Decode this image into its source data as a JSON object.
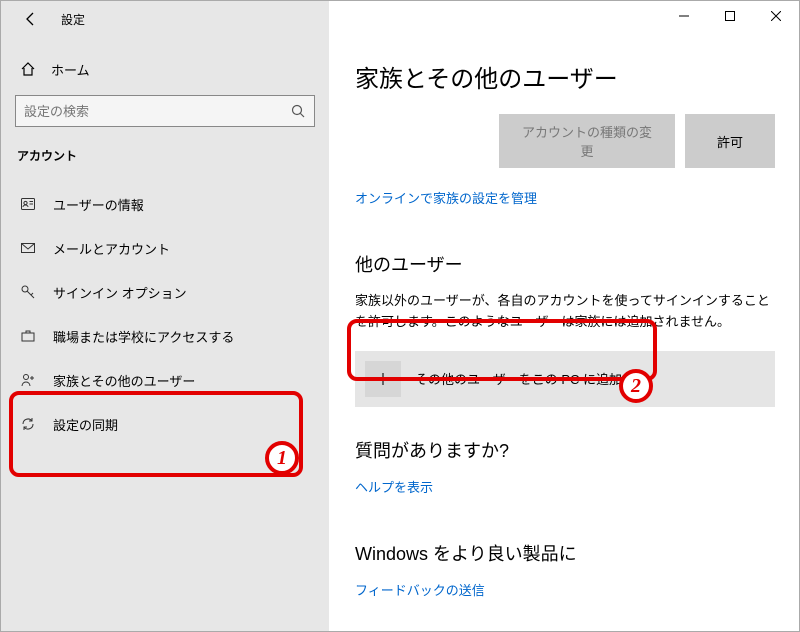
{
  "titlebar": {
    "title": "設定"
  },
  "home": {
    "label": "ホーム"
  },
  "search": {
    "placeholder": "設定の検索"
  },
  "section_header": "アカウント",
  "nav": {
    "items": [
      {
        "label": "ユーザーの情報"
      },
      {
        "label": "メールとアカウント"
      },
      {
        "label": "サインイン オプション"
      },
      {
        "label": "職場または学校にアクセスする"
      },
      {
        "label": "家族とその他のユーザー"
      },
      {
        "label": "設定の同期"
      }
    ]
  },
  "main": {
    "title": "家族とその他のユーザー",
    "btn_change_type": "アカウントの種類の変更",
    "btn_allow": "許可",
    "manage_link": "オンラインで家族の設定を管理",
    "other_users_heading": "他のユーザー",
    "other_users_desc": "家族以外のユーザーが、各自のアカウントを使ってサインインすることを許可します。このようなユーザーは家族には追加されません。",
    "add_user_label": "その他のユーザーをこの PC に追加",
    "question_heading": "質問がありますか?",
    "help_link": "ヘルプを表示",
    "improve_heading": "Windows をより良い製品に",
    "feedback_link": "フィードバックの送信"
  },
  "annotations": {
    "circle1": "1",
    "circle2": "2"
  }
}
